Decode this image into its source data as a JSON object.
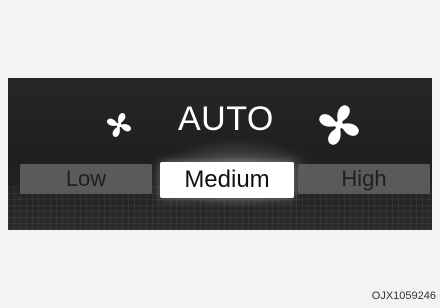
{
  "climate": {
    "mode_label": "AUTO",
    "speeds": {
      "low": "Low",
      "medium": "Medium",
      "high": "High"
    },
    "selected_speed": "Medium"
  },
  "icons": {
    "fan_small": "fan-icon",
    "fan_large": "fan-icon"
  },
  "figure_code": "OJX1059246",
  "colors": {
    "panel": "#262626",
    "selected_bg": "#ffffff",
    "unselected_bg": "#5a5a5a"
  }
}
